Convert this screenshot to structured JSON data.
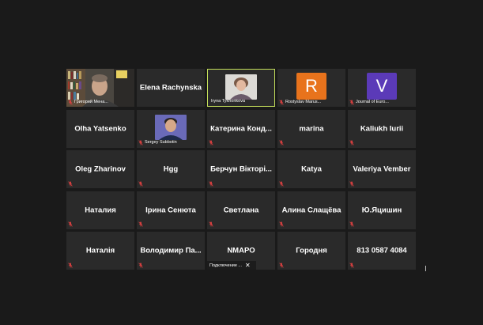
{
  "colors": {
    "background": "#1a1a1a",
    "tile": "#2a2a2a",
    "active_speaker_border": "#c5e05b",
    "muted_mic": "#d64040",
    "avatar_r": "#e8731c",
    "avatar_v": "#5b3ab8"
  },
  "participants": [
    {
      "id": "p1",
      "display": "video",
      "label": "Григорий Мена...",
      "muted": true
    },
    {
      "id": "p2",
      "display": "name",
      "name": "Elena Rachynska",
      "muted": false
    },
    {
      "id": "p3",
      "display": "photo",
      "label": "Iryna Tykhonkova",
      "muted": false,
      "active": true
    },
    {
      "id": "p4",
      "display": "letter",
      "letter": "R",
      "label": "Rostyslav Marus...",
      "muted": true,
      "color": "#e8731c"
    },
    {
      "id": "p5",
      "display": "letter",
      "letter": "V",
      "label": "Journal of Euro...",
      "muted": true,
      "color": "#5b3ab8"
    },
    {
      "id": "p6",
      "display": "name",
      "name": "Olha Yatsenko",
      "muted": false
    },
    {
      "id": "p7",
      "display": "photo",
      "label": "Sergey Subbotin",
      "muted": true
    },
    {
      "id": "p8",
      "display": "name",
      "name": "Катерина  Конд...",
      "muted": true
    },
    {
      "id": "p9",
      "display": "name",
      "name": "marina",
      "muted": true
    },
    {
      "id": "p10",
      "display": "name",
      "name": "Kaliukh Iurii",
      "muted": true
    },
    {
      "id": "p11",
      "display": "name",
      "name": "Oleg Zharinov",
      "muted": true
    },
    {
      "id": "p12",
      "display": "name",
      "name": "Hgg",
      "muted": true
    },
    {
      "id": "p13",
      "display": "name",
      "name": "Берчун  Вікторі...",
      "muted": true
    },
    {
      "id": "p14",
      "display": "name",
      "name": "Katya",
      "muted": true
    },
    {
      "id": "p15",
      "display": "name",
      "name": "Valeriya Vember",
      "muted": true
    },
    {
      "id": "p16",
      "display": "name",
      "name": "Наталия",
      "muted": true
    },
    {
      "id": "p17",
      "display": "name",
      "name": "Ірина Сенюта",
      "muted": true
    },
    {
      "id": "p18",
      "display": "name",
      "name": "Светлана",
      "muted": true
    },
    {
      "id": "p19",
      "display": "name",
      "name": "Алина Слащёва",
      "muted": true
    },
    {
      "id": "p20",
      "display": "name",
      "name": "Ю.Яцишин",
      "muted": true
    },
    {
      "id": "p21",
      "display": "name",
      "name": "Наталія",
      "muted": true
    },
    {
      "id": "p22",
      "display": "name",
      "name": "Володимир  Па...",
      "muted": true
    },
    {
      "id": "p23",
      "display": "name",
      "name": "NMAPO",
      "muted": false,
      "connecting": "Подключение ..."
    },
    {
      "id": "p24",
      "display": "name",
      "name": "Городня",
      "muted": true
    },
    {
      "id": "p25",
      "display": "name",
      "name": "813 0587 4084",
      "muted": true
    }
  ]
}
